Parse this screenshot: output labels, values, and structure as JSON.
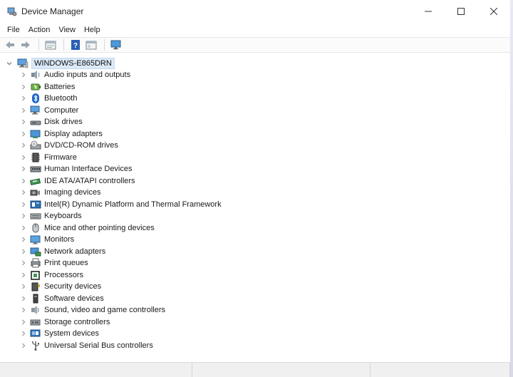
{
  "window": {
    "title": "Device Manager"
  },
  "window_controls": {
    "minimize": "─",
    "maximize": "☐",
    "close": "✕"
  },
  "menu": [
    "File",
    "Action",
    "View",
    "Help"
  ],
  "toolbar": [
    "back-icon",
    "forward-icon",
    "properties-icon",
    "help-icon",
    "view-icon",
    "monitor-scan-icon"
  ],
  "tree": {
    "root": {
      "label": "WINDOWS-E865DRN",
      "icon": "computer-icon",
      "expanded": true
    },
    "items": [
      {
        "label": "Audio inputs and outputs",
        "icon": "speaker-icon"
      },
      {
        "label": "Batteries",
        "icon": "battery-icon"
      },
      {
        "label": "Bluetooth",
        "icon": "bluetooth-icon"
      },
      {
        "label": "Computer",
        "icon": "computer-icon"
      },
      {
        "label": "Disk drives",
        "icon": "disk-drive-icon"
      },
      {
        "label": "Display adapters",
        "icon": "display-adapter-icon"
      },
      {
        "label": "DVD/CD-ROM drives",
        "icon": "dvd-drive-icon"
      },
      {
        "label": "Firmware",
        "icon": "firmware-icon"
      },
      {
        "label": "Human Interface Devices",
        "icon": "hid-icon"
      },
      {
        "label": "IDE ATA/ATAPI controllers",
        "icon": "ide-controller-icon"
      },
      {
        "label": "Imaging devices",
        "icon": "camera-icon"
      },
      {
        "label": "Intel(R) Dynamic Platform and Thermal Framework",
        "icon": "thermal-framework-icon"
      },
      {
        "label": "Keyboards",
        "icon": "keyboard-icon"
      },
      {
        "label": "Mice and other pointing devices",
        "icon": "mouse-icon"
      },
      {
        "label": "Monitors",
        "icon": "monitor-icon"
      },
      {
        "label": "Network adapters",
        "icon": "network-adapter-icon"
      },
      {
        "label": "Print queues",
        "icon": "printer-icon"
      },
      {
        "label": "Processors",
        "icon": "processor-icon"
      },
      {
        "label": "Security devices",
        "icon": "security-device-icon"
      },
      {
        "label": "Software devices",
        "icon": "software-device-icon"
      },
      {
        "label": "Sound, video and game controllers",
        "icon": "sound-controller-icon"
      },
      {
        "label": "Storage controllers",
        "icon": "storage-controller-icon"
      },
      {
        "label": "System devices",
        "icon": "system-devices-icon"
      },
      {
        "label": "Universal Serial Bus controllers",
        "icon": "usb-icon"
      }
    ]
  },
  "colors": {
    "selection": "#dbe8f7",
    "accent": "#2b78d0",
    "statusbar": "#f0f0f0"
  }
}
